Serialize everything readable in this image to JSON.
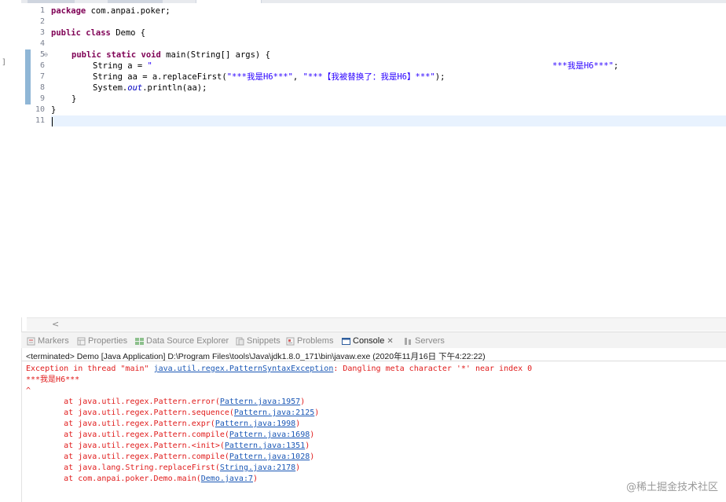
{
  "left_marker": "]",
  "editor": {
    "line_numbers": [
      "1",
      "2",
      "3",
      "4",
      "5",
      "6",
      "7",
      "8",
      "9",
      "10",
      "11"
    ],
    "fold_marker": "⊖",
    "lines": {
      "l1_kw": "package",
      "l1_rest": " com.anpai.poker;",
      "l3_kw1": "public",
      "l3_kw2": "class",
      "l3_rest": " Demo {",
      "l5_kw1": "public",
      "l5_kw2": "static",
      "l5_kw3": "void",
      "l5_rest": " main(String[] args) {",
      "l6_pre": "String a = ",
      "l6_str": "\"",
      "l6_str_end": "***我是H6***\"",
      "l6_semi": ";",
      "l7_pre": "String aa = a.replaceFirst(",
      "l7_str1": "\"***我是H6***\"",
      "l7_comma": ", ",
      "l7_str2": "\"***【我被替换了：我是H6】***\"",
      "l7_end": ");",
      "l8_pre": "System.",
      "l8_field": "out",
      "l8_rest": ".println(aa);",
      "l9": "}",
      "l10": "}"
    },
    "scroll_left": "<"
  },
  "views_bar": {
    "tabs": [
      {
        "label": "Markers",
        "icon": "markers-icon"
      },
      {
        "label": "Properties",
        "icon": "properties-icon"
      },
      {
        "label": "Data Source Explorer",
        "icon": "data-source-icon"
      },
      {
        "label": "Snippets",
        "icon": "snippets-icon"
      },
      {
        "label": "Problems",
        "icon": "problems-icon"
      },
      {
        "label": "Console",
        "icon": "console-icon"
      },
      {
        "label": "Servers",
        "icon": "servers-icon"
      }
    ],
    "close_glyph": "✕"
  },
  "console": {
    "info": "<terminated> Demo [Java Application] D:\\Program Files\\tools\\Java\\jdk1.8.0_171\\bin\\javaw.exe (2020年11月16日 下午4:22:22)",
    "exception_prefix": "Exception in thread \"main\" ",
    "exception_class": "java.util.regex.PatternSyntaxException",
    "exception_msg": ": Dangling meta character '*' near index 0",
    "pattern_line": "***我是H6***",
    "caret_line": "^",
    "stack": [
      {
        "at": "        at java.util.regex.Pattern.error(",
        "link": "Pattern.java:1957",
        "end": ")"
      },
      {
        "at": "        at java.util.regex.Pattern.sequence(",
        "link": "Pattern.java:2125",
        "end": ")"
      },
      {
        "at": "        at java.util.regex.Pattern.expr(",
        "link": "Pattern.java:1998",
        "end": ")"
      },
      {
        "at": "        at java.util.regex.Pattern.compile(",
        "link": "Pattern.java:1698",
        "end": ")"
      },
      {
        "at": "        at java.util.regex.Pattern.<init>(",
        "link": "Pattern.java:1351",
        "end": ")"
      },
      {
        "at": "        at java.util.regex.Pattern.compile(",
        "link": "Pattern.java:1028",
        "end": ")"
      },
      {
        "at": "        at java.lang.String.replaceFirst(",
        "link": "String.java:2178",
        "end": ")"
      },
      {
        "at": "        at com.anpai.poker.Demo.main(",
        "link": "Demo.java:7",
        "end": ")"
      }
    ]
  },
  "watermark": "@稀土掘金技术社区",
  "colors": {
    "keyword": "#7f0055",
    "string": "#2a00ff",
    "error": "#e01b1b",
    "link": "#1a57b5"
  }
}
